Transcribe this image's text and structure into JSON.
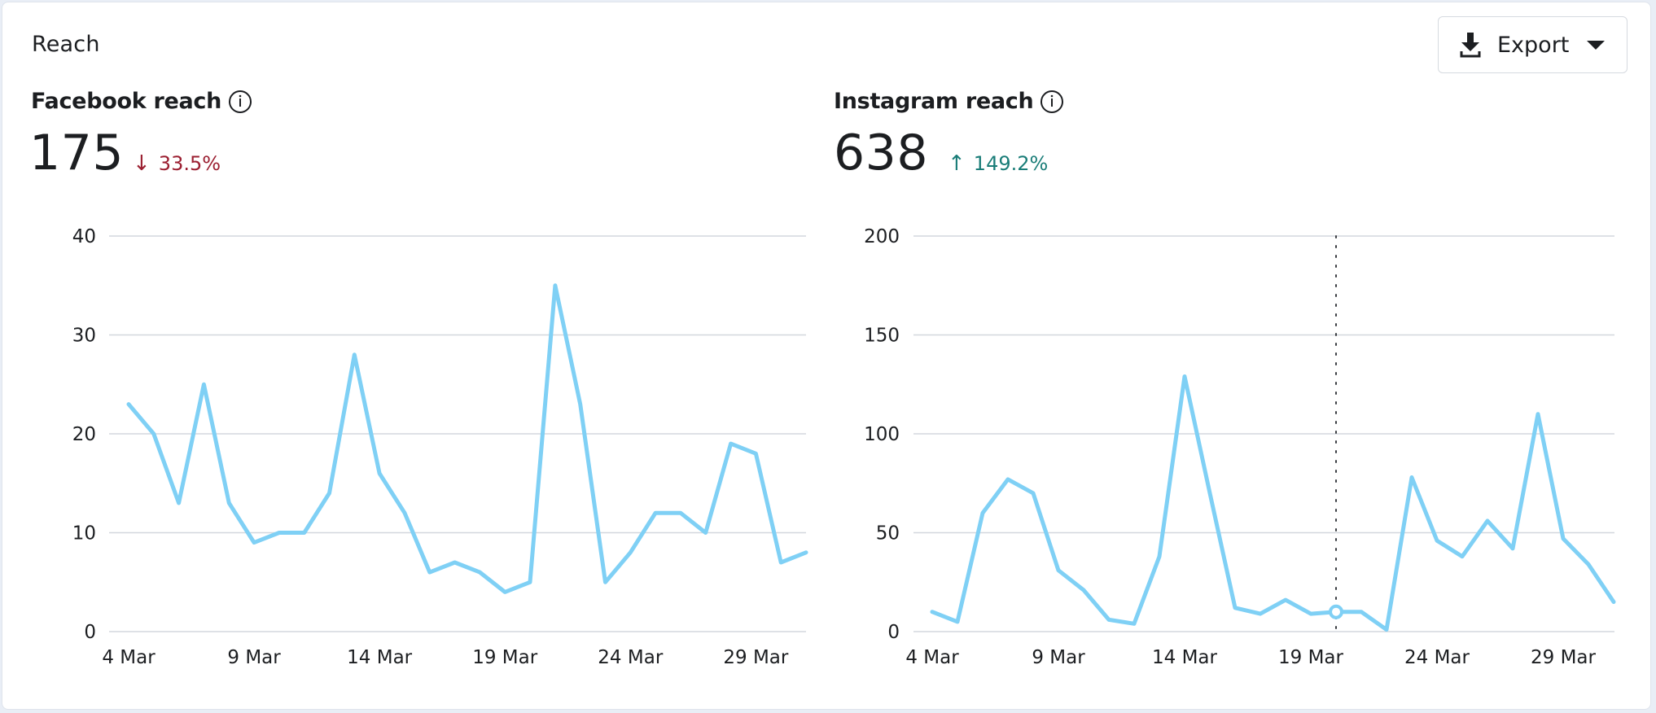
{
  "section_title": "Reach",
  "export_button": {
    "label": "Export",
    "icon": "download-icon",
    "caret_icon": "caret-down-icon"
  },
  "metrics": [
    {
      "name": "Facebook reach",
      "info_icon": "info-icon",
      "value": "175",
      "delta": {
        "direction": "down",
        "arrow": "↓",
        "text": "33.5%",
        "color": "#9b1f31"
      }
    },
    {
      "name": "Instagram reach",
      "info_icon": "info-icon",
      "value": "638",
      "delta": {
        "direction": "up",
        "arrow": "↑",
        "text": "149.2%",
        "color": "#1a7d78"
      }
    }
  ],
  "colors": {
    "line": "#7fd0f5",
    "grid": "#d3d7de",
    "hover_line": "#3a3d42"
  },
  "chart_data": [
    {
      "type": "line",
      "title": "Facebook reach",
      "xlabel": "",
      "ylabel": "",
      "x": [
        "4 Mar",
        "5 Mar",
        "6 Mar",
        "7 Mar",
        "8 Mar",
        "9 Mar",
        "10 Mar",
        "11 Mar",
        "12 Mar",
        "13 Mar",
        "14 Mar",
        "15 Mar",
        "16 Mar",
        "17 Mar",
        "18 Mar",
        "19 Mar",
        "20 Mar",
        "21 Mar",
        "22 Mar",
        "23 Mar",
        "24 Mar",
        "25 Mar",
        "26 Mar",
        "27 Mar",
        "28 Mar",
        "29 Mar",
        "30 Mar",
        "31 Mar"
      ],
      "series": [
        {
          "name": "Facebook reach",
          "values": [
            23,
            20,
            13,
            25,
            13,
            9,
            10,
            10,
            14,
            28,
            16,
            12,
            6,
            7,
            6,
            4,
            5,
            35,
            23,
            5,
            8,
            12,
            12,
            10,
            19,
            18,
            7,
            8
          ]
        }
      ],
      "x_tick_labels": [
        "4 Mar",
        "9 Mar",
        "14 Mar",
        "19 Mar",
        "24 Mar",
        "29 Mar"
      ],
      "y_ticks": [
        0,
        10,
        20,
        30,
        40
      ],
      "ylim": [
        0,
        40
      ],
      "grid": true,
      "legend": "none"
    },
    {
      "type": "line",
      "title": "Instagram reach",
      "xlabel": "",
      "ylabel": "",
      "x": [
        "4 Mar",
        "5 Mar",
        "6 Mar",
        "7 Mar",
        "8 Mar",
        "9 Mar",
        "10 Mar",
        "11 Mar",
        "12 Mar",
        "13 Mar",
        "14 Mar",
        "15 Mar",
        "16 Mar",
        "17 Mar",
        "18 Mar",
        "19 Mar",
        "20 Mar",
        "21 Mar",
        "22 Mar",
        "23 Mar",
        "24 Mar",
        "25 Mar",
        "26 Mar",
        "27 Mar",
        "28 Mar",
        "29 Mar",
        "30 Mar",
        "31 Mar"
      ],
      "series": [
        {
          "name": "Instagram reach",
          "values": [
            10,
            5,
            60,
            77,
            70,
            31,
            21,
            6,
            4,
            38,
            129,
            70,
            12,
            9,
            16,
            9,
            10,
            10,
            1,
            78,
            46,
            38,
            56,
            42,
            110,
            47,
            34,
            15
          ]
        }
      ],
      "x_tick_labels": [
        "4 Mar",
        "9 Mar",
        "14 Mar",
        "19 Mar",
        "24 Mar",
        "29 Mar"
      ],
      "y_ticks": [
        0,
        50,
        100,
        150,
        200
      ],
      "ylim": [
        0,
        200
      ],
      "grid": true,
      "legend": "none",
      "hover": {
        "x": "20 Mar",
        "value": 10
      }
    }
  ]
}
